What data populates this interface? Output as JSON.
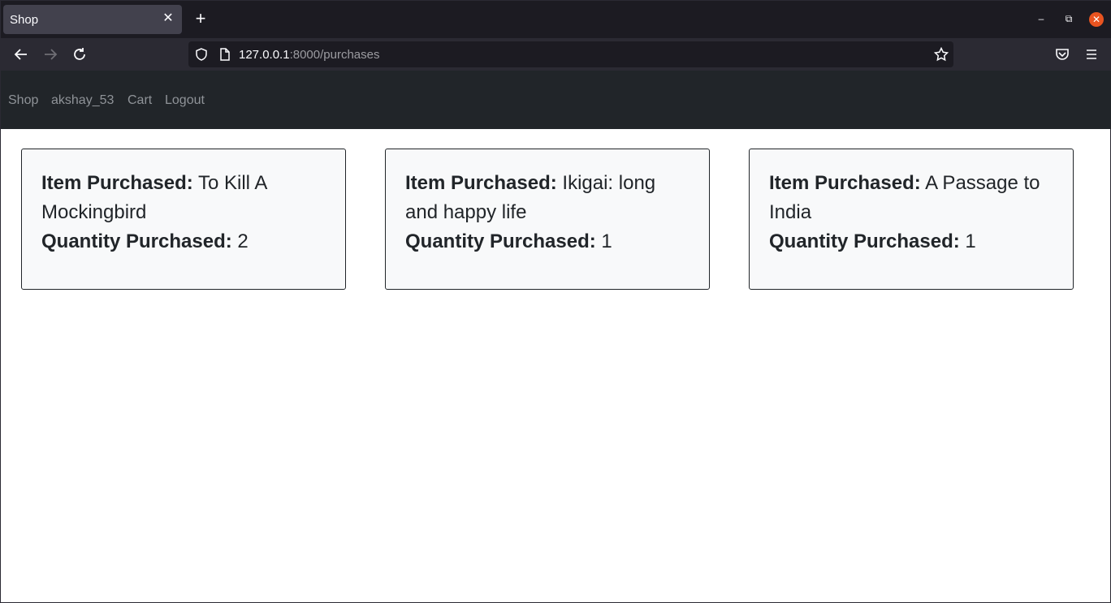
{
  "browser": {
    "tab_title": "Shop",
    "url_host": "127.0.0.1",
    "url_rest": ":8000/purchases"
  },
  "navbar": {
    "links": [
      "Shop",
      "akshay_53",
      "Cart",
      "Logout"
    ]
  },
  "purchases": {
    "item_label": "Item Purchased:",
    "quantity_label": "Quantity Purchased:",
    "items": [
      {
        "item": "To Kill A Mockingbird",
        "quantity": "2"
      },
      {
        "item": "Ikigai: long and happy life",
        "quantity": "1"
      },
      {
        "item": "A Passage to India",
        "quantity": "1"
      }
    ]
  },
  "icons": {
    "back": "arrow-left-icon",
    "forward": "arrow-right-icon",
    "reload": "reload-icon",
    "shield": "shield-icon",
    "page": "page-icon",
    "bookmark": "star-icon",
    "pocket": "pocket-icon",
    "menu": "hamburger-menu-icon"
  }
}
